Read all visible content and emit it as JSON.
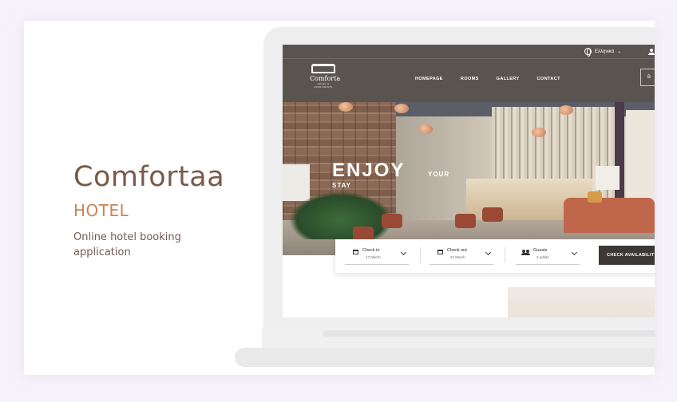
{
  "presentation": {
    "title": "Comfortaa",
    "subtitle": "HOTEL",
    "description": "Online hotel booking application"
  },
  "site": {
    "language": "Ελληνικά",
    "logo": {
      "name": "Comforta",
      "tagline": "HOTEL & APARTMENTS"
    },
    "nav": [
      "HOMEPAGE",
      "ROOMS",
      "GALLERY",
      "CONTACT"
    ],
    "book_label": "B",
    "hero": {
      "line1": "ENJOY",
      "line2": "YOUR",
      "line3": "STAY"
    },
    "booking": {
      "checkin": {
        "label": "Check in",
        "value": "17 March"
      },
      "checkout": {
        "label": "Check out",
        "value": "22 March"
      },
      "guests": {
        "label": "Guests",
        "value": "2 adults"
      },
      "button": "CHECK AVAILABILITY"
    }
  },
  "colors": {
    "title": "#7a5a4a",
    "accent": "#c88456",
    "header": "#5a5451",
    "button": "#3b3836"
  }
}
